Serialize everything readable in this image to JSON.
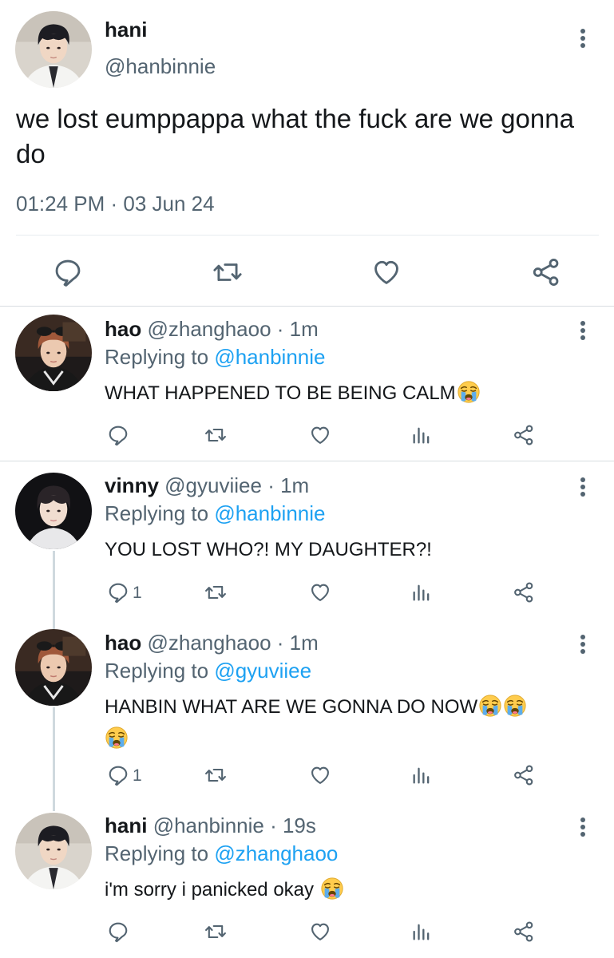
{
  "main_tweet": {
    "name": "hani",
    "handle": "@hanbinnie",
    "text": "we lost eumppappa what the fuck are we gonna do",
    "timestamp": "01:24 PM · 03 Jun 24",
    "actions": [
      "reply-icon",
      "retweet-icon",
      "like-icon",
      "share-icon"
    ]
  },
  "replies": [
    {
      "name": "hao",
      "handle": "@zhanghaoo",
      "time": "· 1m",
      "replying_label": "Replying to",
      "replying_to": "@hanbinnie",
      "text": "WHAT HAPPENED TO BE BEING CALM",
      "emojis": [
        "loudly-crying-face"
      ],
      "reply_count": ""
    },
    {
      "name": "vinny",
      "handle": "@gyuviiee",
      "time": "· 1m",
      "replying_label": "Replying to",
      "replying_to": "@hanbinnie",
      "text": "YOU LOST WHO?! MY DAUGHTER?!",
      "emojis": [],
      "reply_count": "1"
    },
    {
      "name": "hao",
      "handle": "@zhanghaoo",
      "time": "· 1m",
      "replying_label": "Replying to",
      "replying_to": "@gyuviiee",
      "text": "HANBIN WHAT ARE WE GONNA DO NOW",
      "emojis": [
        "loudly-crying-face",
        "loudly-crying-face",
        "loudly-crying-face"
      ],
      "reply_count": "1"
    },
    {
      "name": "hani",
      "handle": "@hanbinnie",
      "time": "· 19s",
      "replying_label": "Replying to",
      "replying_to": "@zhanghaoo",
      "text": "i'm sorry i panicked okay",
      "emojis": [
        "loudly-crying-face"
      ],
      "reply_count": ""
    }
  ],
  "colors": {
    "text": "#14171a",
    "secondary": "#536471",
    "link": "#1da1f2",
    "divider": "#e6ecf0",
    "thread_line": "#cfd9de"
  }
}
